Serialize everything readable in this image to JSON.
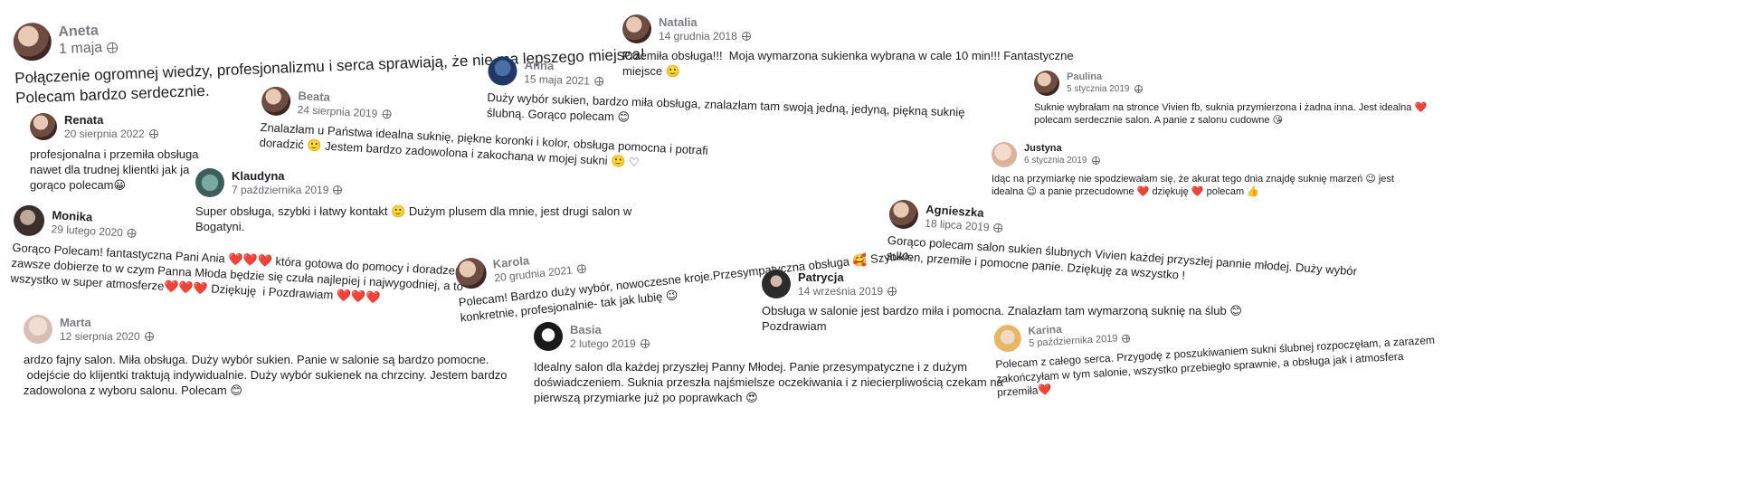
{
  "reviews": [
    {
      "name": "Aneta",
      "date": "1 maja",
      "text": "Połączenie ogromnej wiedzy, profesjonalizmu i serca sprawiają, że nie ma lepszego miejsca!\nPolecam bardzo serdecznie."
    },
    {
      "name": "Renata",
      "date": "20 sierpnia 2022",
      "text": "profesjonalna i przemiła obsługa\nnawet dla trudnej klientki jak ja\ngorąco polecam😀"
    },
    {
      "name": "Beata",
      "date": "24 sierpnia 2019",
      "text": "Znalazłam u Państwa idealna suknię, piękne koronki i kolor, obsługa pomocna i potrafi\ndoradzić 🙂 Jestem bardzo zadowolona i zakochana w mojej sukni 🙂 ♡"
    },
    {
      "name": "Anna",
      "date": "15 maja 2021",
      "text": "Duży wybór sukien, bardzo miła obsługa, znalazłam tam swoją jedną, jedyną, piękną suknię\nślubną. Gorąco polecam 😊"
    },
    {
      "name": "Natalia",
      "date": "14 grudnia 2018",
      "text": "Przemiła obsługa!!!  Moja wymarzona sukienka wybrana w cale 10 min!!! Fantastyczne\nmiejsce 🙂"
    },
    {
      "name": "Paulina",
      "date": "5 stycznia 2019",
      "text": "Suknie wybrałam na stronce Vivien fb, suknia przymierzona i żadna inna. Jest idealna ❤️\npolecam serdecznie salon. A panie z salonu cudowne 😘"
    },
    {
      "name": "Justyna",
      "date": "6 stycznia 2019",
      "text": "Idąc na przymiarkę nie spodziewałam się, że akurat tego dnia znajdę suknię marzeń 😉 jest\nidealna 😉 a panie przecudowne ❤️ dziękuję ❤️ polecam 👍"
    },
    {
      "name": "Klaudyna",
      "date": "7 października 2019",
      "text": "Super obsługa, szybki i łatwy kontakt 🙂 Dużym plusem dla mnie, jest drugi salon w\nBogatyni."
    },
    {
      "name": "Monika",
      "date": "29 lutego 2020",
      "text": "Gorąco Polecam! fantastyczna Pani Ania ❤️❤️❤️ która gotowa do pomocy i doradzenia\nzawsze dobierze to w czym Panna Młoda będzie się czuła najlepiej i najwygodniej, a to\nwszystko w super atmosferze❤️❤️❤️ Dziękuję  i Pozdrawiam ❤️❤️❤️"
    },
    {
      "name": "Karola",
      "date": "20 grudnia 2021",
      "text": "Polecam! Bardzo duży wybór, nowoczesne kroje.Przesympatyczna obsługa 🥰 Szybko,\nkonkretnie, profesjonalnie- tak jak lubię 😉"
    },
    {
      "name": "Agnieszka",
      "date": "18 lipca 2019",
      "text": "Gorąco polecam salon sukien ślubnych Vivien każdej przyszłej pannie młodej. Duży wybór\nsukien, przemiłe i pomocne panie. Dziękuję za wszystko !"
    },
    {
      "name": "Patrycja",
      "date": "14 września 2019",
      "text": "Obsługa w salonie jest bardzo miła i pomocna. Znalazłam tam wymarzoną suknię na ślub 😊\nPozdrawiam"
    },
    {
      "name": "Marta",
      "date": "12 sierpnia 2020",
      "text": "ardzo fajny salon. Miła obsługa. Duży wybór sukien. Panie w salonie są bardzo pomocne.\n odejście do klijentki traktują indywidualnie. Duży wybór sukienek na chrzciny. Jestem bardzo\nzadowolona z wyboru salonu. Polecam 😊"
    },
    {
      "name": "Basia",
      "date": "2 lutego 2019",
      "text": "Idealny salon dla każdej przyszłej Panny Młodej. Panie przesympatyczne i z dużym\ndoświadczeniem. Suknia przeszła najśmielsze oczekiwania i z niecierpliwością czekam na\npierwszą przymiarke już po poprawkach 😍"
    },
    {
      "name": "Karina",
      "date": "5 października 2019",
      "text": "Polecam z całego serca. Przygodę z poszukiwaniem sukni ślubnej rozpoczęłam, a zarazem\nzakończyłam w tym salonie, wszystko przebiegło sprawnie, a obsługa jak i atmosfera\nprzemiła❤️"
    }
  ],
  "icons": {
    "privacy": "globe-icon",
    "avatar": "profile-photo"
  }
}
